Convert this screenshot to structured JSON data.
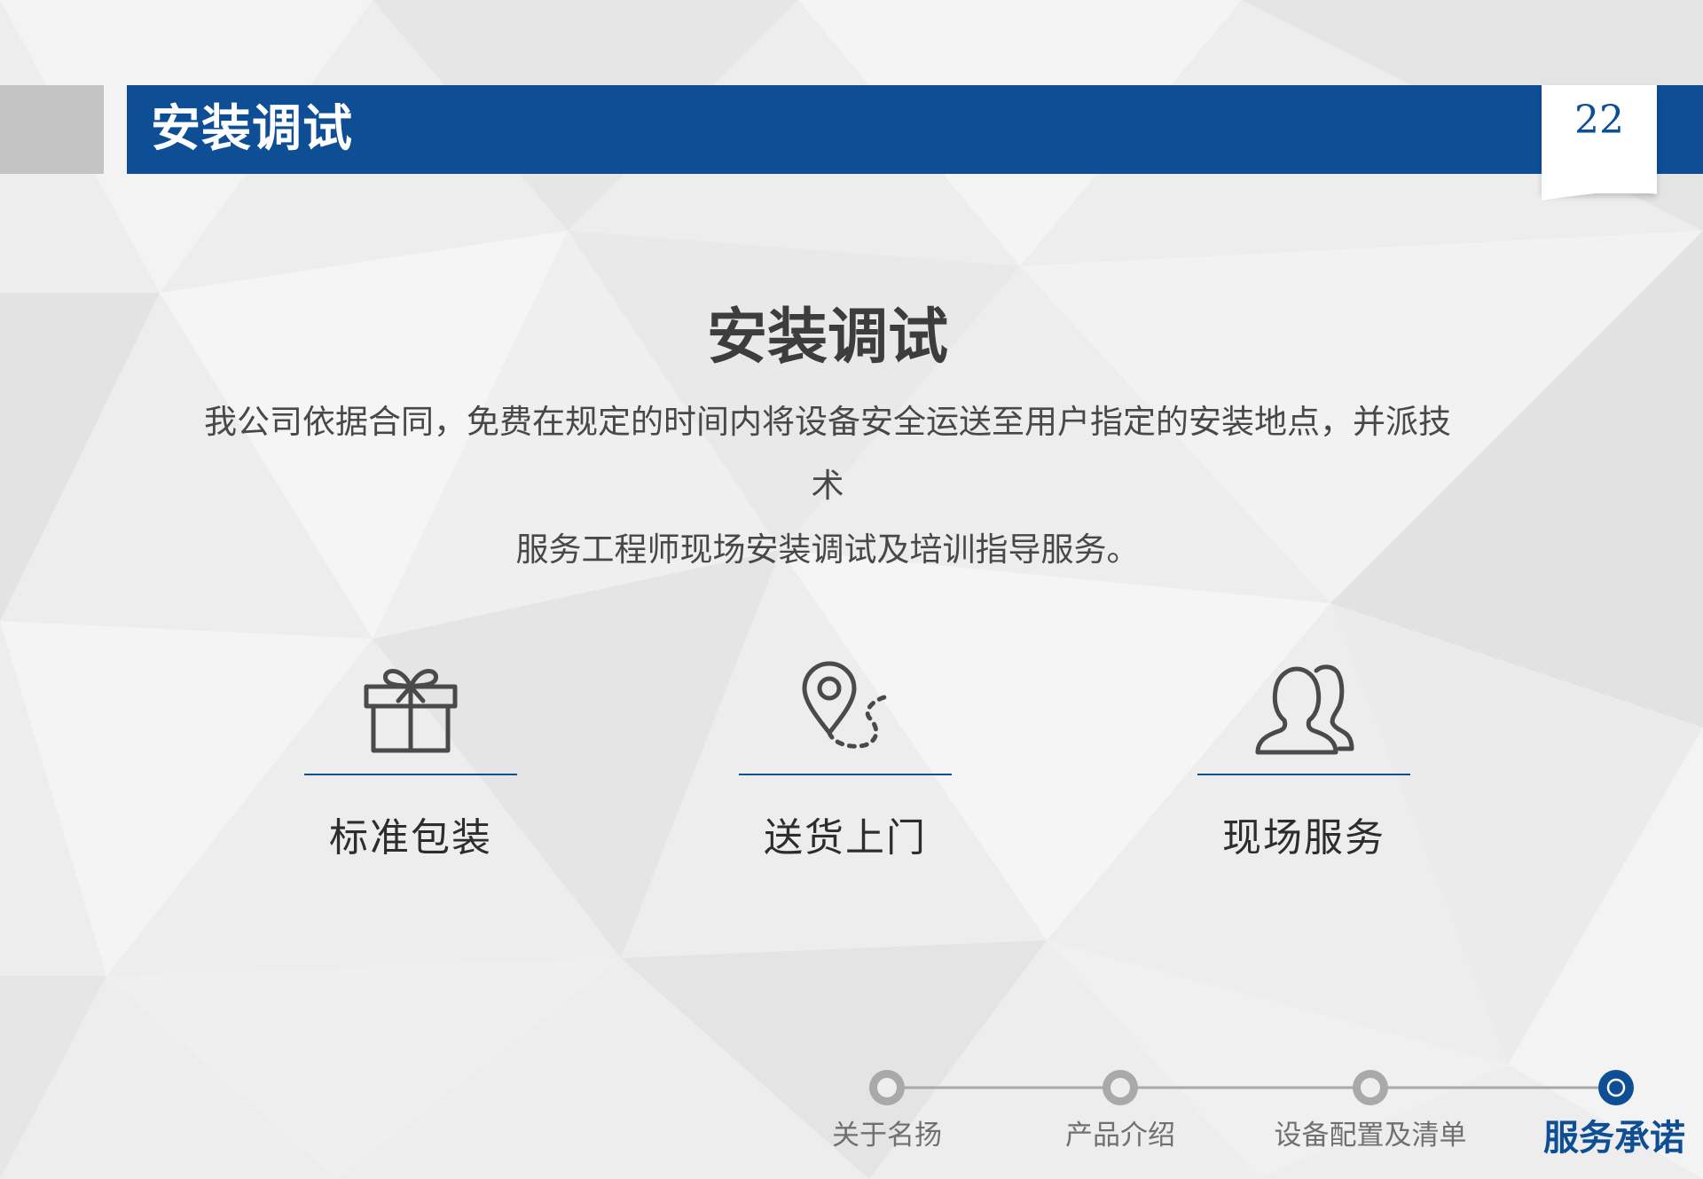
{
  "header": {
    "title": "安装调试",
    "page_number": "22"
  },
  "main": {
    "title": "安装调试",
    "description_line1": "我公司依据合同，免费在规定的时间内将设备安全运送至用户指定的安装地点，并派技术",
    "description_line2": "服务工程师现场安装调试及培训指导服务。"
  },
  "features": [
    {
      "label": "标准包装",
      "icon": "gift-icon"
    },
    {
      "label": "送货上门",
      "icon": "location-route-icon"
    },
    {
      "label": "现场服务",
      "icon": "users-icon"
    }
  ],
  "progress": {
    "steps": [
      {
        "label": "关于名扬"
      },
      {
        "label": "产品介绍"
      },
      {
        "label": "设备配置及清单"
      },
      {
        "label": "服务承诺"
      }
    ],
    "active_index": 3
  },
  "colors": {
    "accent": "#0e4e95",
    "header_gray": "#c4c4c4",
    "text_dark": "#3d3d3d",
    "step_inactive": "#a9a9a9"
  }
}
